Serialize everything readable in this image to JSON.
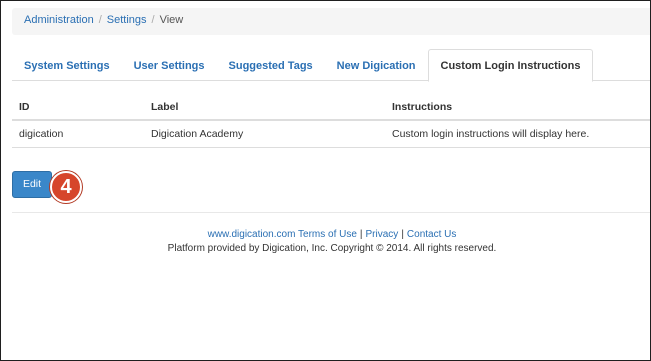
{
  "breadcrumb": {
    "items": [
      "Administration",
      "Settings",
      "View"
    ],
    "separator": "/"
  },
  "tabs": [
    {
      "label": "System Settings",
      "active": false
    },
    {
      "label": "User Settings",
      "active": false
    },
    {
      "label": "Suggested Tags",
      "active": false
    },
    {
      "label": "New Digication",
      "active": false
    },
    {
      "label": "Custom Login Instructions",
      "active": true
    }
  ],
  "table": {
    "headers": [
      "ID",
      "Label",
      "Instructions"
    ],
    "rows": [
      [
        "digication",
        "Digication Academy",
        "Custom login instructions will display here."
      ]
    ]
  },
  "actions": {
    "edit_label": "Edit",
    "step_number": "4"
  },
  "footer": {
    "terms_link": "www.digication.com Terms of Use",
    "privacy_link": "Privacy",
    "contact_link": "Contact Us",
    "divider": "|",
    "copyright": "Platform provided by Digication, Inc. Copyright © 2014. All rights reserved."
  },
  "colors": {
    "link": "#2a6fb3",
    "primary_button": "#3a87c9",
    "step_badge": "#d6452b"
  }
}
